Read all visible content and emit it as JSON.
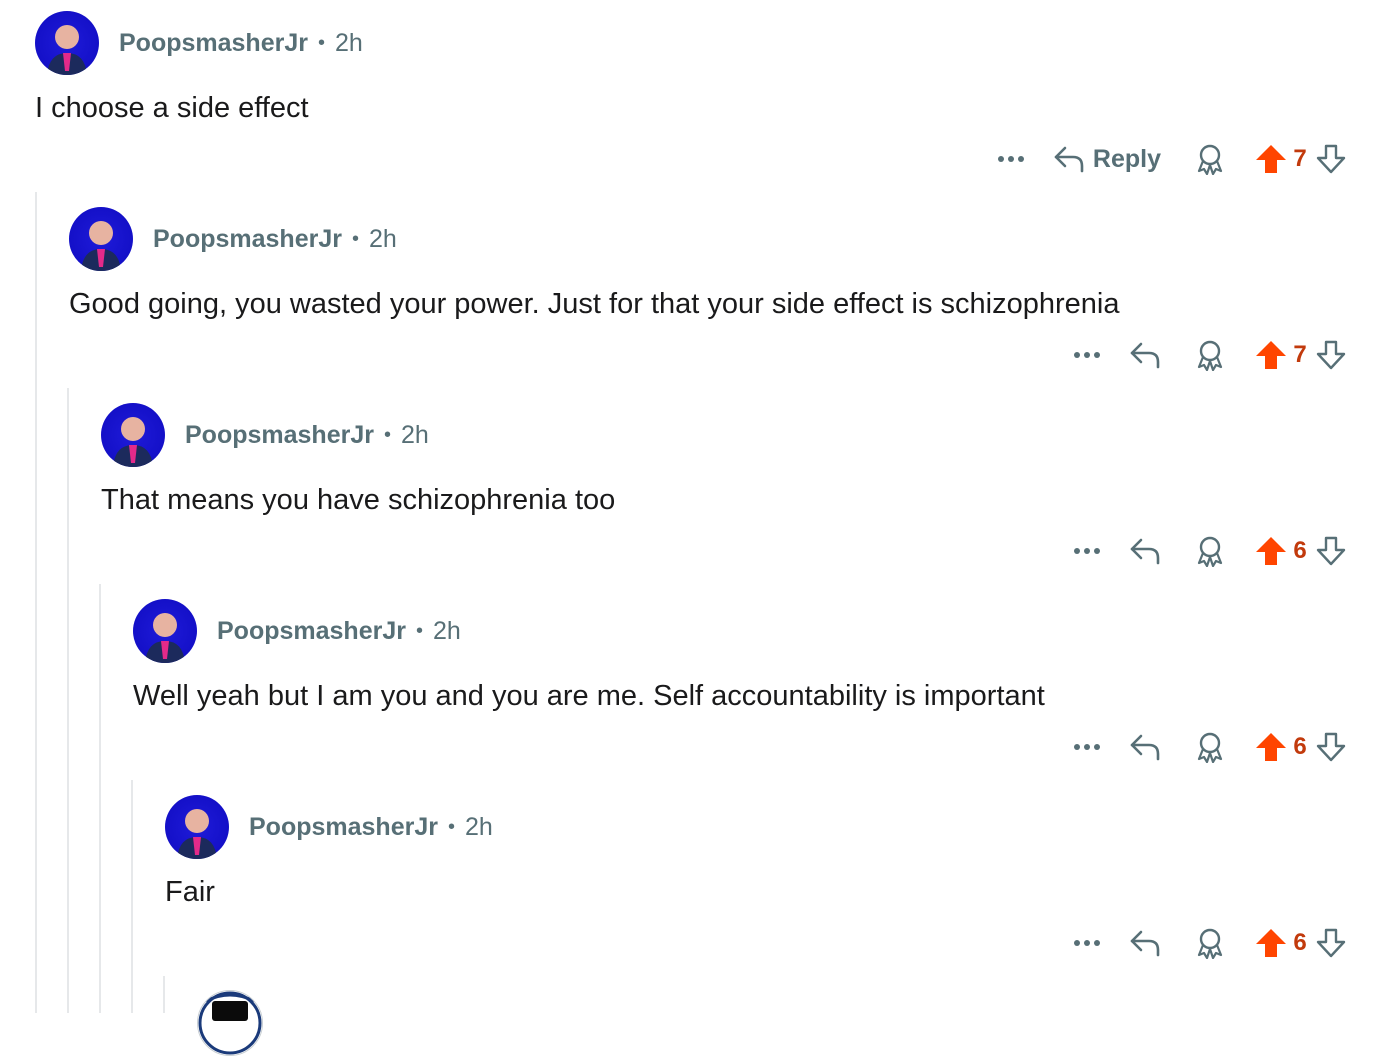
{
  "comments": [
    {
      "author": "PoopsmasherJr",
      "time": "2h",
      "text": "I choose a side effect",
      "votes": "7",
      "reply_label": "Reply"
    },
    {
      "author": "PoopsmasherJr",
      "time": "2h",
      "text": "Good going, you wasted your power. Just for that your side effect is schizophrenia",
      "votes": "7",
      "reply_label": ""
    },
    {
      "author": "PoopsmasherJr",
      "time": "2h",
      "text": "That means you have schizophrenia too",
      "votes": "6",
      "reply_label": ""
    },
    {
      "author": "PoopsmasherJr",
      "time": "2h",
      "text": "Well yeah but I am you and you are me. Self accountability is important",
      "votes": "6",
      "reply_label": ""
    },
    {
      "author": "PoopsmasherJr",
      "time": "2h",
      "text": "Fair",
      "votes": "6",
      "reply_label": ""
    }
  ],
  "separator": "•",
  "icons": {
    "more": "more-options-icon",
    "reply": "reply-arrow-icon",
    "award": "award-icon",
    "upvote": "upvote-arrow-icon",
    "downvote": "downvote-arrow-icon"
  },
  "colors": {
    "upvote_active": "#ff4500",
    "vote_count": "#c23a0c",
    "meta_text": "#576f76",
    "avatar_bg": "#1410c8",
    "thread_line": "#e6e8ea"
  }
}
